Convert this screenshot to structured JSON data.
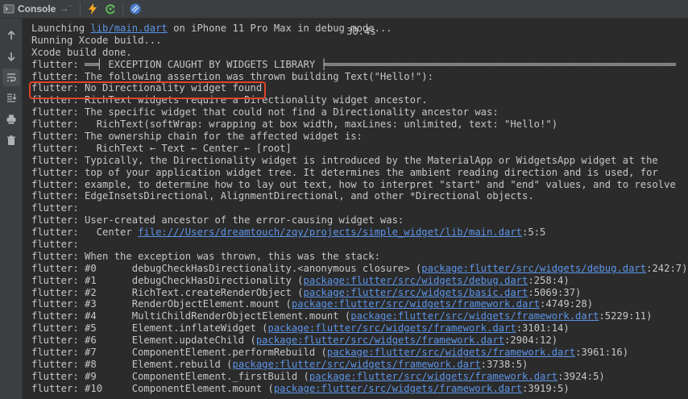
{
  "toolbar": {
    "tab_label": "Console",
    "tab_suffix": "→ʿ"
  },
  "elapsed": "30.4s",
  "console": {
    "lines": [
      [
        {
          "t": "Launching "
        },
        {
          "t": "lib/main.dart",
          "link": true
        },
        {
          "t": " on iPhone 11 Pro Max in debug mode..."
        }
      ],
      [
        {
          "t": "Running Xcode build..."
        }
      ],
      [
        {
          "t": "Xcode build done."
        }
      ],
      [
        {
          "t": "flutter: ══╡ EXCEPTION CAUGHT BY WIDGETS LIBRARY ╞═══════════════════════════════════════════════════════════"
        }
      ],
      [
        {
          "t": "flutter: The following assertion was thrown building Text(\"Hello!\"):"
        }
      ],
      [
        {
          "t": "flutter: No Directionality widget found."
        }
      ],
      [
        {
          "t": "flutter: RichText widgets require a Directionality widget ancestor."
        }
      ],
      [
        {
          "t": "flutter: The specific widget that could not find a Directionality ancestor was:"
        }
      ],
      [
        {
          "t": "flutter:   RichText(softWrap: wrapping at box width, maxLines: unlimited, text: \"Hello!\")"
        }
      ],
      [
        {
          "t": "flutter: The ownership chain for the affected widget is:"
        }
      ],
      [
        {
          "t": "flutter:   RichText ← Text ← Center ← [root]"
        }
      ],
      [
        {
          "t": "flutter: Typically, the Directionality widget is introduced by the MaterialApp or WidgetsApp widget at the"
        }
      ],
      [
        {
          "t": "flutter: top of your application widget tree. It determines the ambient reading direction and is used, for"
        }
      ],
      [
        {
          "t": "flutter: example, to determine how to lay out text, how to interpret \"start\" and \"end\" values, and to resolve"
        }
      ],
      [
        {
          "t": "flutter: EdgeInsetsDirectional, AlignmentDirectional, and other *Directional objects."
        }
      ],
      [
        {
          "t": "flutter:"
        }
      ],
      [
        {
          "t": "flutter: User-created ancestor of the error-causing widget was:"
        }
      ],
      [
        {
          "t": "flutter:   Center "
        },
        {
          "t": "file:///Users/dreamtouch/zqy/projects/simple_widget/lib/main.dart",
          "link": true
        },
        {
          "t": ":5:5"
        }
      ],
      [
        {
          "t": "flutter:"
        }
      ],
      [
        {
          "t": "flutter: When the exception was thrown, this was the stack:"
        }
      ],
      [
        {
          "t": "flutter: #0      debugCheckHasDirectionality.<anonymous closure> ("
        },
        {
          "t": "package:flutter/src/widgets/debug.dart",
          "link": true
        },
        {
          "t": ":242:7)"
        }
      ],
      [
        {
          "t": "flutter: #1      debugCheckHasDirectionality ("
        },
        {
          "t": "package:flutter/src/widgets/debug.dart",
          "link": true
        },
        {
          "t": ":258:4)"
        }
      ],
      [
        {
          "t": "flutter: #2      RichText.createRenderObject ("
        },
        {
          "t": "package:flutter/src/widgets/basic.dart",
          "link": true
        },
        {
          "t": ":5069:37)"
        }
      ],
      [
        {
          "t": "flutter: #3      RenderObjectElement.mount ("
        },
        {
          "t": "package:flutter/src/widgets/framework.dart",
          "link": true
        },
        {
          "t": ":4749:28)"
        }
      ],
      [
        {
          "t": "flutter: #4      MultiChildRenderObjectElement.mount ("
        },
        {
          "t": "package:flutter/src/widgets/framework.dart",
          "link": true
        },
        {
          "t": ":5229:11)"
        }
      ],
      [
        {
          "t": "flutter: #5      Element.inflateWidget ("
        },
        {
          "t": "package:flutter/src/widgets/framework.dart",
          "link": true
        },
        {
          "t": ":3101:14)"
        }
      ],
      [
        {
          "t": "flutter: #6      Element.updateChild ("
        },
        {
          "t": "package:flutter/src/widgets/framework.dart",
          "link": true
        },
        {
          "t": ":2904:12)"
        }
      ],
      [
        {
          "t": "flutter: #7      ComponentElement.performRebuild ("
        },
        {
          "t": "package:flutter/src/widgets/framework.dart",
          "link": true
        },
        {
          "t": ":3961:16)"
        }
      ],
      [
        {
          "t": "flutter: #8      Element.rebuild ("
        },
        {
          "t": "package:flutter/src/widgets/framework.dart",
          "link": true
        },
        {
          "t": ":3738:5)"
        }
      ],
      [
        {
          "t": "flutter: #9      ComponentElement._firstBuild ("
        },
        {
          "t": "package:flutter/src/widgets/framework.dart",
          "link": true
        },
        {
          "t": ":3924:5)"
        }
      ],
      [
        {
          "t": "flutter: #10     ComponentElement.mount ("
        },
        {
          "t": "package:flutter/src/widgets/framework.dart",
          "link": true
        },
        {
          "t": ":3919:5)"
        }
      ]
    ]
  },
  "icons": {
    "console": "console-icon",
    "open_arrow": "arrow-right-icon",
    "hot_reload": "lightning-icon",
    "hot_restart": "restart-icon",
    "inspector": "flutter-inspector-icon",
    "up": "arrow-up-icon",
    "down": "arrow-down-icon",
    "wrap": "soft-wrap-icon",
    "scroll_end": "scroll-to-end-icon",
    "print": "print-icon",
    "trash": "trash-icon"
  },
  "colors": {
    "background": "#2b2b2b",
    "toolbar": "#3c3f41",
    "text": "#c7c7c7",
    "link": "#5c94e8",
    "highlight": "#e0432a",
    "lightning": "#f5a623",
    "restart": "#5fb85a"
  }
}
